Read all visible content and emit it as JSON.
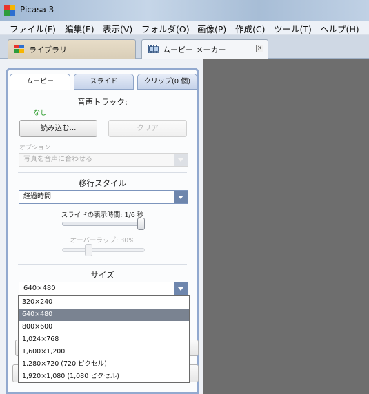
{
  "window": {
    "title": "Picasa 3"
  },
  "menu": [
    "ファイル(F)",
    "編集(E)",
    "表示(V)",
    "フォルダ(O)",
    "画像(P)",
    "作成(C)",
    "ツール(T)",
    "ヘルプ(H)"
  ],
  "tabs": {
    "library": "ライブラリ",
    "movie_maker": "ムービー メーカー",
    "close_glyph": "×"
  },
  "panel_tabs": [
    "ムービー",
    "スライド",
    "クリップ(0 個)"
  ],
  "audio": {
    "title": "音声トラック:",
    "status": "なし",
    "load_button": "読み込む...",
    "clear_button": "クリア",
    "options_label": "オプション",
    "options_value": "写真を音声に合わせる"
  },
  "transition": {
    "title": "移行スタイル",
    "value": "経過時間",
    "duration_label": "スライドの表示時間: 1/6 秒",
    "overlap_label": "オーバーラップ: 30%",
    "duration_level": 1.0,
    "overlap_level": 0.3
  },
  "size": {
    "title": "サイズ",
    "value": "640×480",
    "options": [
      "320×240",
      "640×480",
      "800×600",
      "1,024×768",
      "1,600×1,200",
      "1,280×720 (720 ピクセル)",
      "1,920×1,080 (1,080 ピクセル)"
    ],
    "selected_index": 1
  },
  "colors": {
    "accent": "#6e86ad",
    "panel_border": "#92a9cf",
    "status_green": "#2a9b2a",
    "preview_bg": "#6e6e6e"
  }
}
